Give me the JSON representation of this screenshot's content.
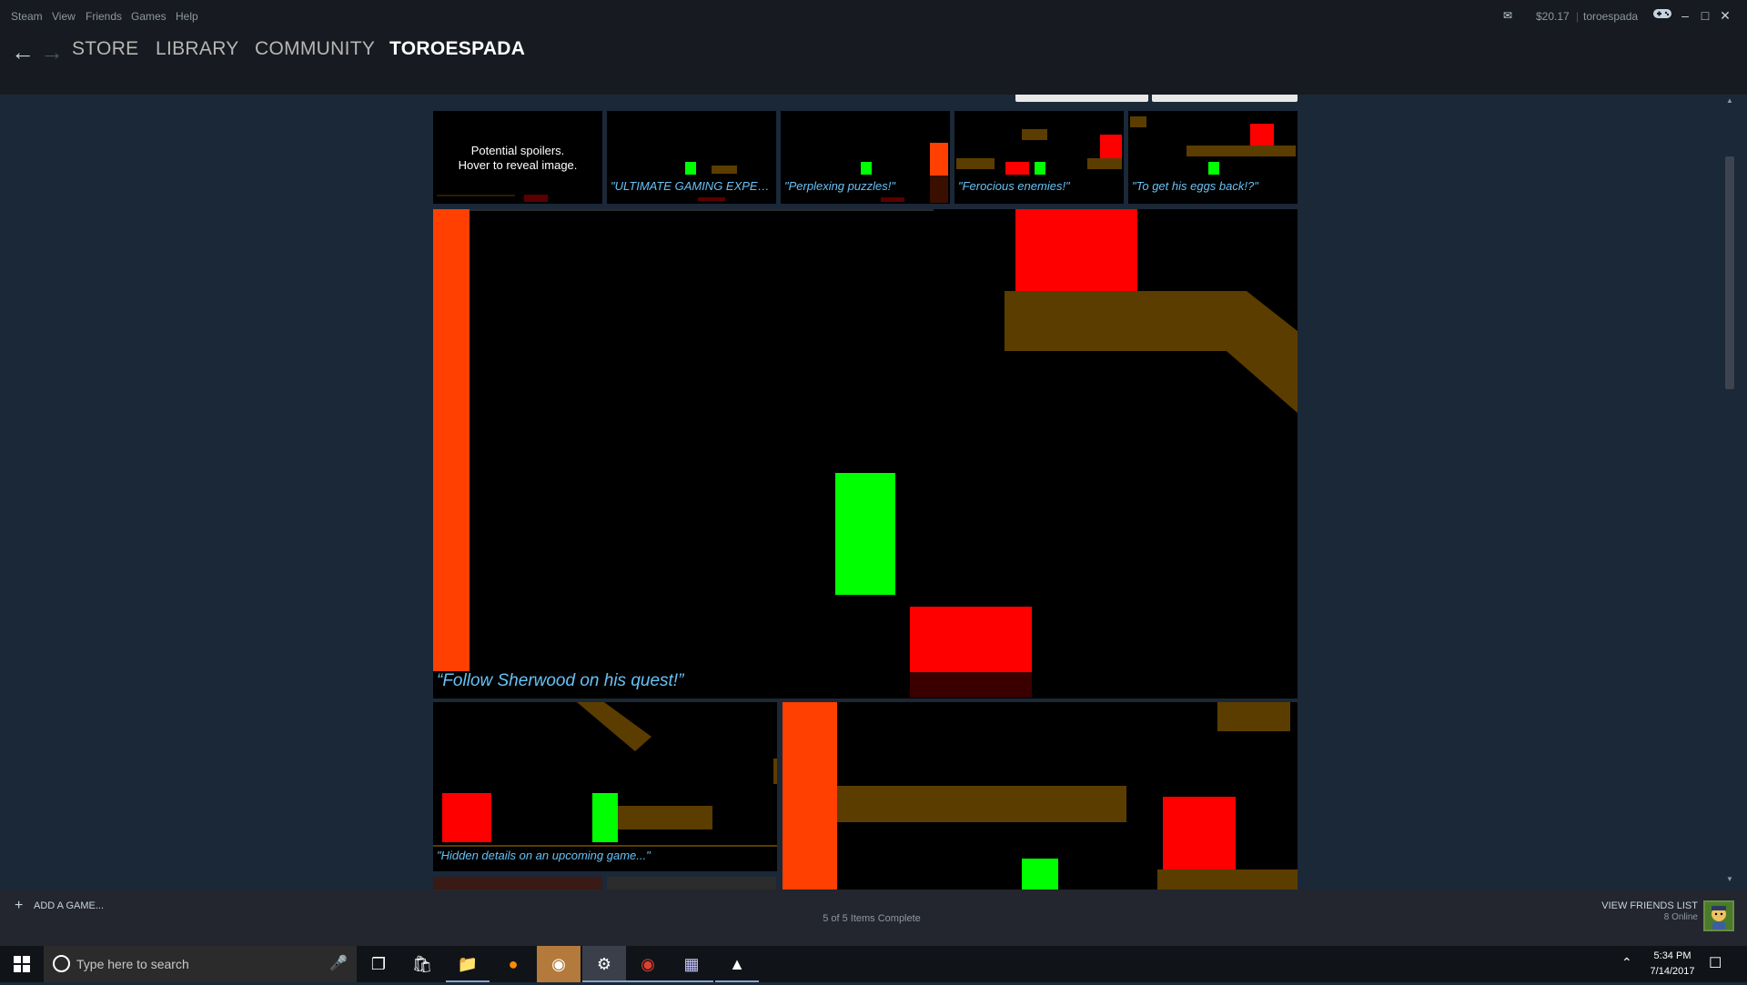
{
  "menu": {
    "items": [
      "Steam",
      "View",
      "Friends",
      "Games",
      "Help"
    ],
    "wallet": "$20.17",
    "username": "toroespada"
  },
  "nav": {
    "back_icon": "back-arrow-icon",
    "forward_icon": "forward-arrow-icon",
    "tabs": [
      "STORE",
      "LIBRARY",
      "COMMUNITY",
      "TOROESPADA"
    ],
    "active_tab": "TOROESPADA"
  },
  "screenshots": {
    "spoiler_text_line1": "Potential spoilers.",
    "spoiler_text_line2": "Hover to reveal image.",
    "captions": [
      "\"ULTIMATE GAMING EXPE…",
      "\"Perplexing puzzles!\"",
      "\"Ferocious enemies!\"",
      "\"To get his eggs back!?\"",
      "“Follow Sherwood on his quest!”",
      "\"Hidden details on an upcoming game...\""
    ]
  },
  "bottom": {
    "add_game": "ADD A GAME...",
    "status": "5 of 5 Items Complete",
    "friends_label": "VIEW FRIENDS LIST",
    "friends_online": "8 Online"
  },
  "taskbar": {
    "search_placeholder": "Type here to search",
    "time": "5:34 PM",
    "date": "7/14/2017"
  },
  "colors": {
    "steam_bg": "#1b2838",
    "steam_header": "#171a21",
    "caption_blue": "#67c1f5",
    "orange": "#ff4000",
    "red": "#ff0000",
    "green": "#00ff00",
    "brown": "#5c3d00"
  }
}
